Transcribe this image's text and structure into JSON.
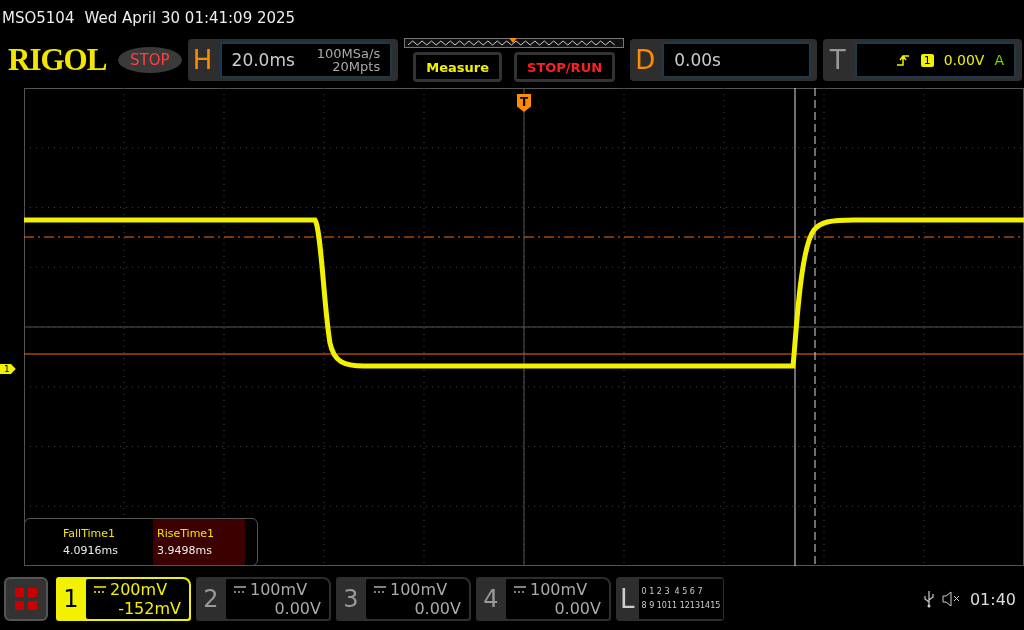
{
  "status_line": {
    "model": "MSO5104",
    "datetime": "Wed April 30 01:41:09 2025"
  },
  "toolbar": {
    "logo": "RIGOL",
    "run_state": "STOP",
    "horizontal": {
      "label": "H",
      "timebase": "20.0ms",
      "sample_rate": "100MSa/s",
      "memory_depth": "20Mpts"
    },
    "buttons": [
      {
        "label": "Measure",
        "kind": "measure"
      },
      {
        "label": "STOP/RUN",
        "kind": "run"
      }
    ],
    "delay": {
      "label": "D",
      "value": "0.00s"
    },
    "trigger": {
      "label": "T",
      "source": "1",
      "level": "0.00V",
      "mode": "A"
    }
  },
  "display": {
    "trigger_marker": "T",
    "channel_marker": "1",
    "measurements": [
      {
        "name": "FallTime1",
        "value": "4.0916ms",
        "selected": false
      },
      {
        "name": "RiseTime1",
        "value": "3.9498ms",
        "selected": true
      }
    ]
  },
  "channels": [
    {
      "number": "1",
      "scale": "200mV",
      "offset": "-152mV",
      "active": true
    },
    {
      "number": "2",
      "scale": "100mV",
      "offset": "0.00V",
      "active": false
    },
    {
      "number": "3",
      "scale": "100mV",
      "offset": "0.00V",
      "active": false
    },
    {
      "number": "4",
      "scale": "100mV",
      "offset": "0.00V",
      "active": false
    }
  ],
  "logic": {
    "label": "L",
    "rows": [
      "0 1 2 3  4 5 6 7",
      "8 9 1011 12131415"
    ]
  },
  "status_bar": {
    "time": "01:40"
  }
}
